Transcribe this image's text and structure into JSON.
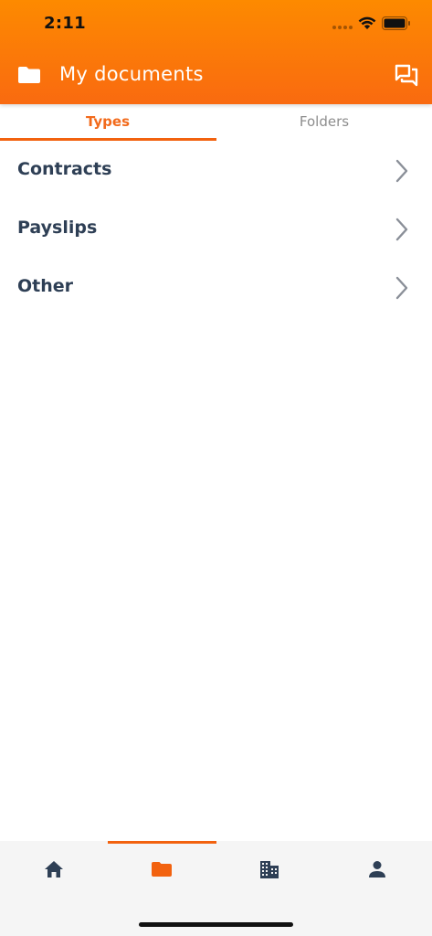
{
  "status_bar": {
    "time": "2:11"
  },
  "header": {
    "title": "My documents",
    "left_icon": "folder-icon",
    "right_icon": "chat-icon"
  },
  "tabs": [
    {
      "label": "Types",
      "active": true
    },
    {
      "label": "Folders",
      "active": false
    }
  ],
  "list": {
    "items": [
      {
        "label": "Contracts"
      },
      {
        "label": "Payslips"
      },
      {
        "label": "Other"
      }
    ]
  },
  "bottom_nav": {
    "items": [
      {
        "icon": "home-icon",
        "active": false
      },
      {
        "icon": "folder-icon",
        "active": true
      },
      {
        "icon": "building-icon",
        "active": false
      },
      {
        "icon": "person-icon",
        "active": false
      }
    ]
  },
  "colors": {
    "accent": "#f2620f",
    "header_top": "#fd8a00",
    "header_bottom": "#f96a10",
    "text_dark": "#2e3f55",
    "tab_inactive": "#8d8d8d",
    "nav_background": "#f5f5f5"
  }
}
